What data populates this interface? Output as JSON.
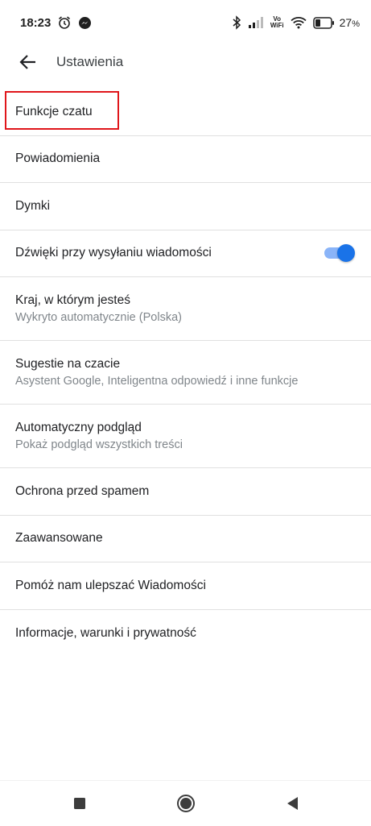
{
  "status_bar": {
    "time": "18:23",
    "battery_percent": "27",
    "battery_suffix": "%",
    "vowifi_top": "Vo",
    "vowifi_bottom": "WiFi",
    "icons": [
      "alarm-icon",
      "messenger-icon",
      "bluetooth-icon",
      "signal-icon",
      "vowifi-icon",
      "wifi-icon",
      "battery-icon"
    ]
  },
  "app_bar": {
    "title": "Ustawienia",
    "back_icon": "arrow-back-icon"
  },
  "settings": {
    "items": [
      {
        "title": "Funkcje czatu"
      },
      {
        "title": "Powiadomienia"
      },
      {
        "title": "Dymki"
      },
      {
        "title": "Dźwięki przy wysyłaniu wiadomości",
        "toggle": true
      },
      {
        "title": "Kraj, w którym jesteś",
        "subtitle": "Wykryto automatycznie (Polska)"
      },
      {
        "title": "Sugestie na czacie",
        "subtitle": "Asystent Google, Inteligentna odpowiedź i inne funkcje"
      },
      {
        "title": "Automatyczny podgląd",
        "subtitle": "Pokaż podgląd wszystkich treści"
      },
      {
        "title": "Ochrona przed spamem"
      },
      {
        "title": "Zaawansowane"
      },
      {
        "title": "Pomóż nam ulepszać Wiadomości"
      },
      {
        "title": "Informacje, warunki i prywatność"
      }
    ]
  },
  "colors": {
    "accent": "#1a73e8",
    "highlight": "#e0161b"
  },
  "nav_bar": {
    "buttons": [
      "recents-square-icon",
      "home-circle-icon",
      "back-triangle-icon"
    ]
  }
}
